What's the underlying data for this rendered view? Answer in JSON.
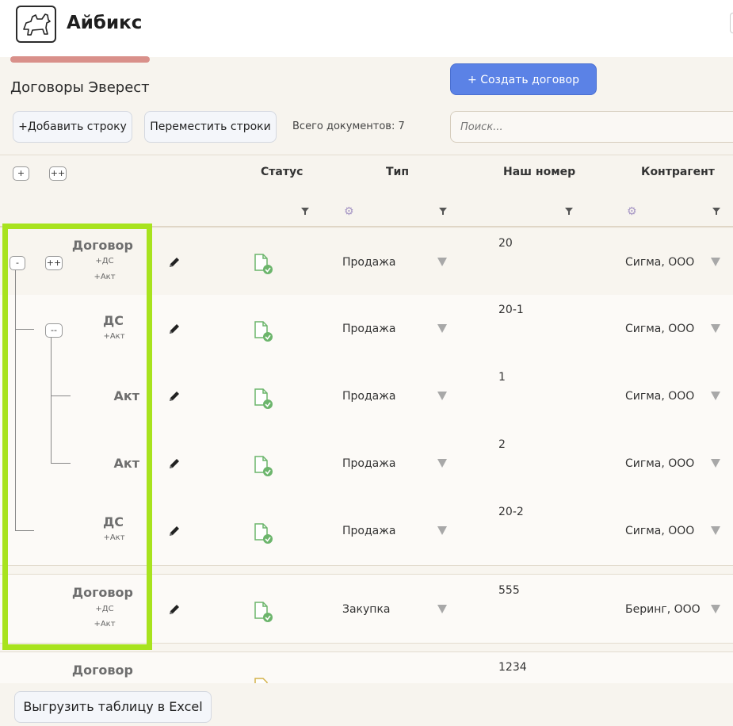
{
  "app": {
    "title": "Айбикс",
    "logo_icon": "scottie-dog-icon"
  },
  "page": {
    "title": "Договоры Эверест"
  },
  "toolbar": {
    "create_label": "+ Создать договор",
    "add_row_label": "+Добавить строку",
    "move_rows_label": "Переместить строки",
    "doc_count": "Всего документов: 7",
    "search_placeholder": "Поиск..."
  },
  "table": {
    "expand_all": "+",
    "expand_all_deep": "++",
    "columns": {
      "status": "Статус",
      "type": "Тип",
      "our_number": "Наш номер",
      "counterparty": "Контрагент"
    },
    "rows": [
      {
        "name": "Договор",
        "subs": [
          "+ДС",
          "+Акт"
        ],
        "type": "Продажа",
        "number": "20",
        "counterparty": "Сигма, ООО",
        "toggle": "-",
        "toggle2": "++"
      },
      {
        "name": "ДС",
        "subs": [
          "+Акт"
        ],
        "type": "Продажа",
        "number": "20-1",
        "counterparty": "Сигма, ООО",
        "toggle": "--"
      },
      {
        "name": "Акт",
        "subs": [],
        "type": "Продажа",
        "number": "1",
        "counterparty": "Сигма, ООО"
      },
      {
        "name": "Акт",
        "subs": [],
        "type": "Продажа",
        "number": "2",
        "counterparty": "Сигма, ООО"
      },
      {
        "name": "ДС",
        "subs": [
          "+Акт"
        ],
        "type": "Продажа",
        "number": "20-2",
        "counterparty": "Сигма, ООО"
      },
      {
        "name": "Договор",
        "subs": [
          "+ДС",
          "+Акт"
        ],
        "type": "Закупка",
        "number": "555",
        "counterparty": "Беринг, ООО"
      },
      {
        "name": "Договор",
        "subs": [],
        "type": "",
        "number": "1234",
        "counterparty": ""
      }
    ]
  },
  "footer": {
    "export_label": "Выгрузить таблицу в Excel"
  },
  "colors": {
    "accent": "#5b82e6",
    "highlight": "#a8e31e",
    "tab_underline": "#d9908a",
    "status_ok": "#6cb56c"
  }
}
